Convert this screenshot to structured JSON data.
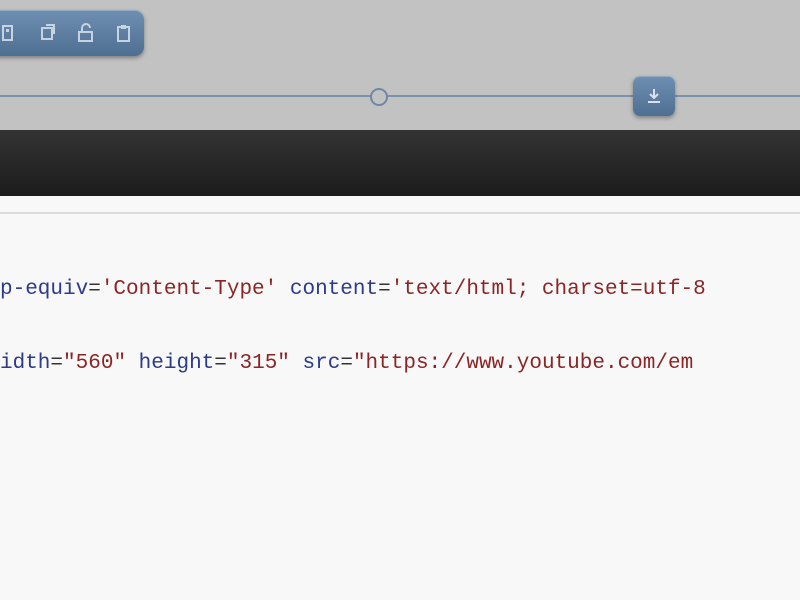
{
  "toolbar": {
    "icons": [
      "toolbar-icon-1",
      "toolbar-icon-2",
      "lock-icon",
      "clipboard-icon"
    ]
  },
  "timeline": {
    "knob_icon": "circle-knob",
    "handle_icon": "download-icon"
  },
  "code": {
    "line1": {
      "attr1": "p-equiv",
      "eq1": "=",
      "val1": "'Content-Type'",
      "space1": " ",
      "attr2": "content",
      "eq2": "=",
      "val2": "'text/html; charset=utf-8"
    },
    "line2": {
      "attr1": "idth",
      "eq1": "=",
      "val1": "\"560\"",
      "space1": " ",
      "attr2": "height",
      "eq2": "=",
      "val2": "\"315\"",
      "space2": " ",
      "attr3": "src",
      "eq3": "=",
      "val3": "\"https://www.youtube.com/em"
    }
  }
}
